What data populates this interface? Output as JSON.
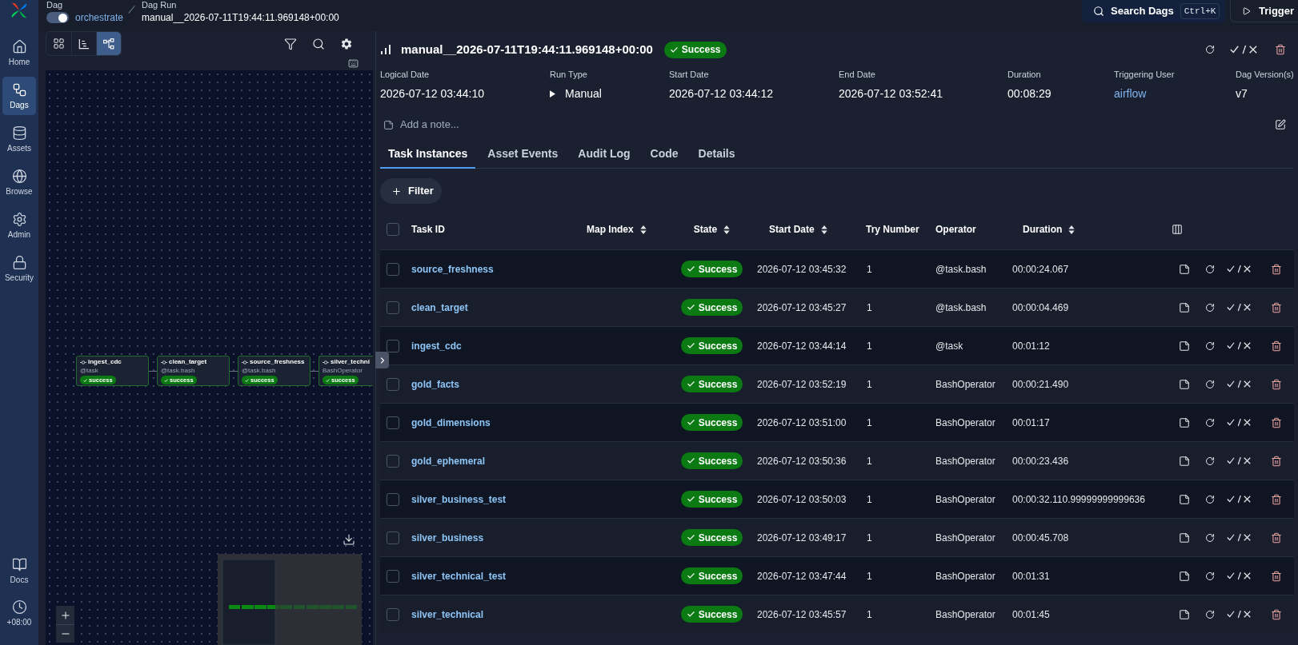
{
  "sidebar": {
    "items": [
      {
        "label": "Home",
        "selected": false
      },
      {
        "label": "Dags",
        "selected": true
      },
      {
        "label": "Assets",
        "selected": false
      },
      {
        "label": "Browse",
        "selected": false
      },
      {
        "label": "Admin",
        "selected": false
      },
      {
        "label": "Security",
        "selected": false
      }
    ],
    "footer_items": [
      {
        "label": "Docs"
      },
      {
        "label": "+08:00"
      }
    ]
  },
  "breadcrumb": {
    "dag": {
      "label": "Dag",
      "enabled": true,
      "name": "orchestrate"
    },
    "run": {
      "label": "Dag Run",
      "name": "manual__2026-07-11T19:44:11.969148+00:00"
    }
  },
  "top_bar": {
    "search_button": {
      "label": "Search Dags",
      "shortcut": "Ctrl+K"
    },
    "trigger_button": {
      "label": "Trigger"
    }
  },
  "view_modes": [
    {
      "selected": false
    },
    {
      "selected": false
    },
    {
      "selected": true
    }
  ],
  "graph": {
    "nodes": [
      {
        "task": "ingest_cdc",
        "operator": "@task",
        "state": "success"
      },
      {
        "task": "clean_target",
        "operator": "@task.bash",
        "state": "success"
      },
      {
        "task": "source_freshness",
        "operator": "@task.bash",
        "state": "success"
      },
      {
        "task": "silver_techni",
        "operator": "BashOperator",
        "state": "success"
      }
    ]
  },
  "run": {
    "title": "manual__2026-07-11T19:44:11.969148+00:00",
    "state": "Success",
    "details": [
      {
        "label": "Logical Date",
        "value": "2026-07-12 03:44:10",
        "kind": "text"
      },
      {
        "label": "Run Type",
        "value": "Manual",
        "kind": "run_type"
      },
      {
        "label": "Start Date",
        "value": "2026-07-12 03:44:12",
        "kind": "text"
      },
      {
        "label": "End Date",
        "value": "2026-07-12 03:52:41",
        "kind": "text"
      },
      {
        "label": "Duration",
        "value": "00:08:29",
        "kind": "text"
      },
      {
        "label": "Triggering User",
        "value": "airflow",
        "kind": "link"
      },
      {
        "label": "Dag Version(s)",
        "value": "v7",
        "kind": "text"
      }
    ],
    "note": {
      "placeholder": "Add a note..."
    }
  },
  "tabs": [
    {
      "label": "Task Instances",
      "selected": true
    },
    {
      "label": "Asset Events",
      "selected": false
    },
    {
      "label": "Audit Log",
      "selected": false
    },
    {
      "label": "Code",
      "selected": false
    },
    {
      "label": "Details",
      "selected": false
    }
  ],
  "filter_button": {
    "label": "Filter"
  },
  "table": {
    "header_checkbox": {
      "checked": false
    },
    "columns": [
      {
        "label": "Task ID",
        "sortable": false
      },
      {
        "label": "Map Index",
        "sortable": true
      },
      {
        "label": "State",
        "sortable": true
      },
      {
        "label": "Start Date",
        "sortable": true
      },
      {
        "label": "Try Number",
        "sortable": false
      },
      {
        "label": "Operator",
        "sortable": false
      },
      {
        "label": "Duration",
        "sortable": true
      }
    ],
    "rows": [
      {
        "selected": false,
        "task_id": "source_freshness",
        "state": "Success",
        "start_date": "2026-07-12 03:45:32",
        "try_number": "1",
        "operator": "@task.bash",
        "duration": "00:00:24.067"
      },
      {
        "selected": false,
        "task_id": "clean_target",
        "state": "Success",
        "start_date": "2026-07-12 03:45:27",
        "try_number": "1",
        "operator": "@task.bash",
        "duration": "00:00:04.469"
      },
      {
        "selected": false,
        "task_id": "ingest_cdc",
        "state": "Success",
        "start_date": "2026-07-12 03:44:14",
        "try_number": "1",
        "operator": "@task",
        "duration": "00:01:12"
      },
      {
        "selected": false,
        "task_id": "gold_facts",
        "state": "Success",
        "start_date": "2026-07-12 03:52:19",
        "try_number": "1",
        "operator": "BashOperator",
        "duration": "00:00:21.490"
      },
      {
        "selected": false,
        "task_id": "gold_dimensions",
        "state": "Success",
        "start_date": "2026-07-12 03:51:00",
        "try_number": "1",
        "operator": "BashOperator",
        "duration": "00:01:17"
      },
      {
        "selected": false,
        "task_id": "gold_ephemeral",
        "state": "Success",
        "start_date": "2026-07-12 03:50:36",
        "try_number": "1",
        "operator": "BashOperator",
        "duration": "00:00:23.436"
      },
      {
        "selected": false,
        "task_id": "silver_business_test",
        "state": "Success",
        "start_date": "2026-07-12 03:50:03",
        "try_number": "1",
        "operator": "BashOperator",
        "duration": "00:00:32.110.99999999999636"
      },
      {
        "selected": false,
        "task_id": "silver_business",
        "state": "Success",
        "start_date": "2026-07-12 03:49:17",
        "try_number": "1",
        "operator": "BashOperator",
        "duration": "00:00:45.708"
      },
      {
        "selected": false,
        "task_id": "silver_technical_test",
        "state": "Success",
        "start_date": "2026-07-12 03:47:44",
        "try_number": "1",
        "operator": "BashOperator",
        "duration": "00:01:31"
      },
      {
        "selected": false,
        "task_id": "silver_technical",
        "state": "Success",
        "start_date": "2026-07-12 03:45:57",
        "try_number": "1",
        "operator": "BashOperator",
        "duration": "00:01:45"
      }
    ]
  }
}
